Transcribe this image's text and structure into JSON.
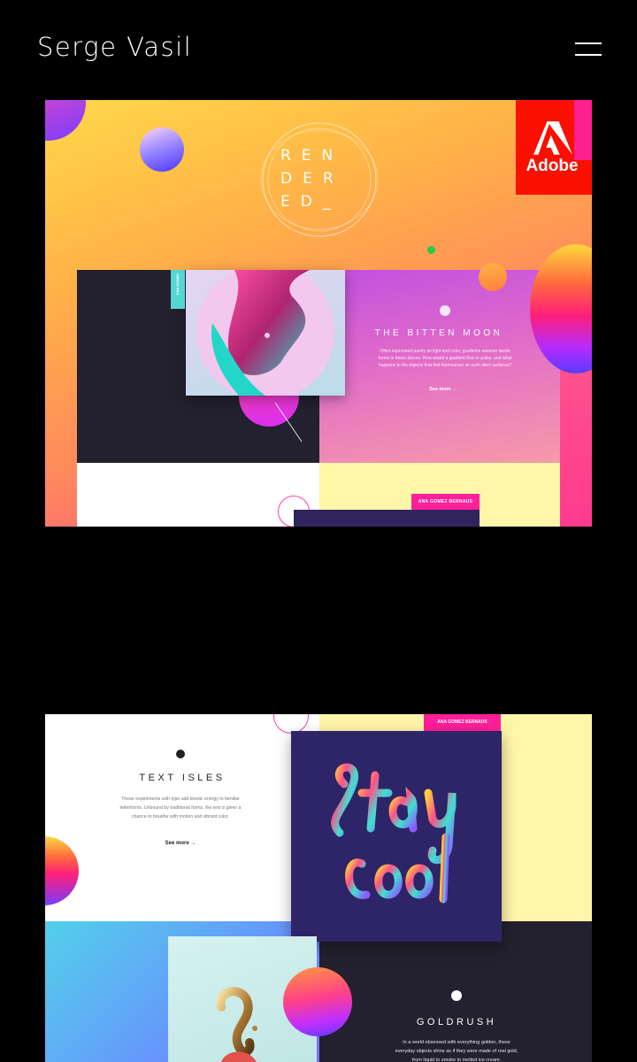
{
  "header": {
    "title": "Serge Vasil",
    "menu_icon": "hamburger-icon"
  },
  "card1": {
    "logo": {
      "line1": "REN",
      "line2": "DER",
      "line3": "ED_"
    },
    "brand_label": "Adobe",
    "tag_vertical": "ANA GOMEZ",
    "article": {
      "title": "THE BITTEN MOON",
      "description": "Often expressed purely as light and color, gradients assume tactile forms in these pieces. How would a gradient flow or pulse, and what happens to the objects that find themselves on such alien surfaces?",
      "link": "See more →"
    },
    "author_tag": "ANA GOMEZ BERNAUS",
    "colors": {
      "adobe_red": "#fa0f00",
      "accent_pink": "#ff1f9a"
    }
  },
  "card2": {
    "author_tag": "ANA GOMEZ BERNAUS",
    "article1": {
      "title": "TEXT ISLES",
      "description": "These experiments with type add kinetic energy to familiar letterforms. Unbound by traditional forms, the text is given a chance to breathe with motion and vibrant color.",
      "link": "See more →"
    },
    "article2": {
      "title": "GOLDRUSH",
      "description": "In a world obsessed with everything golden, these everyday objects shine as if they were made of real gold, from liquid to smoke to melted ice cream."
    }
  }
}
